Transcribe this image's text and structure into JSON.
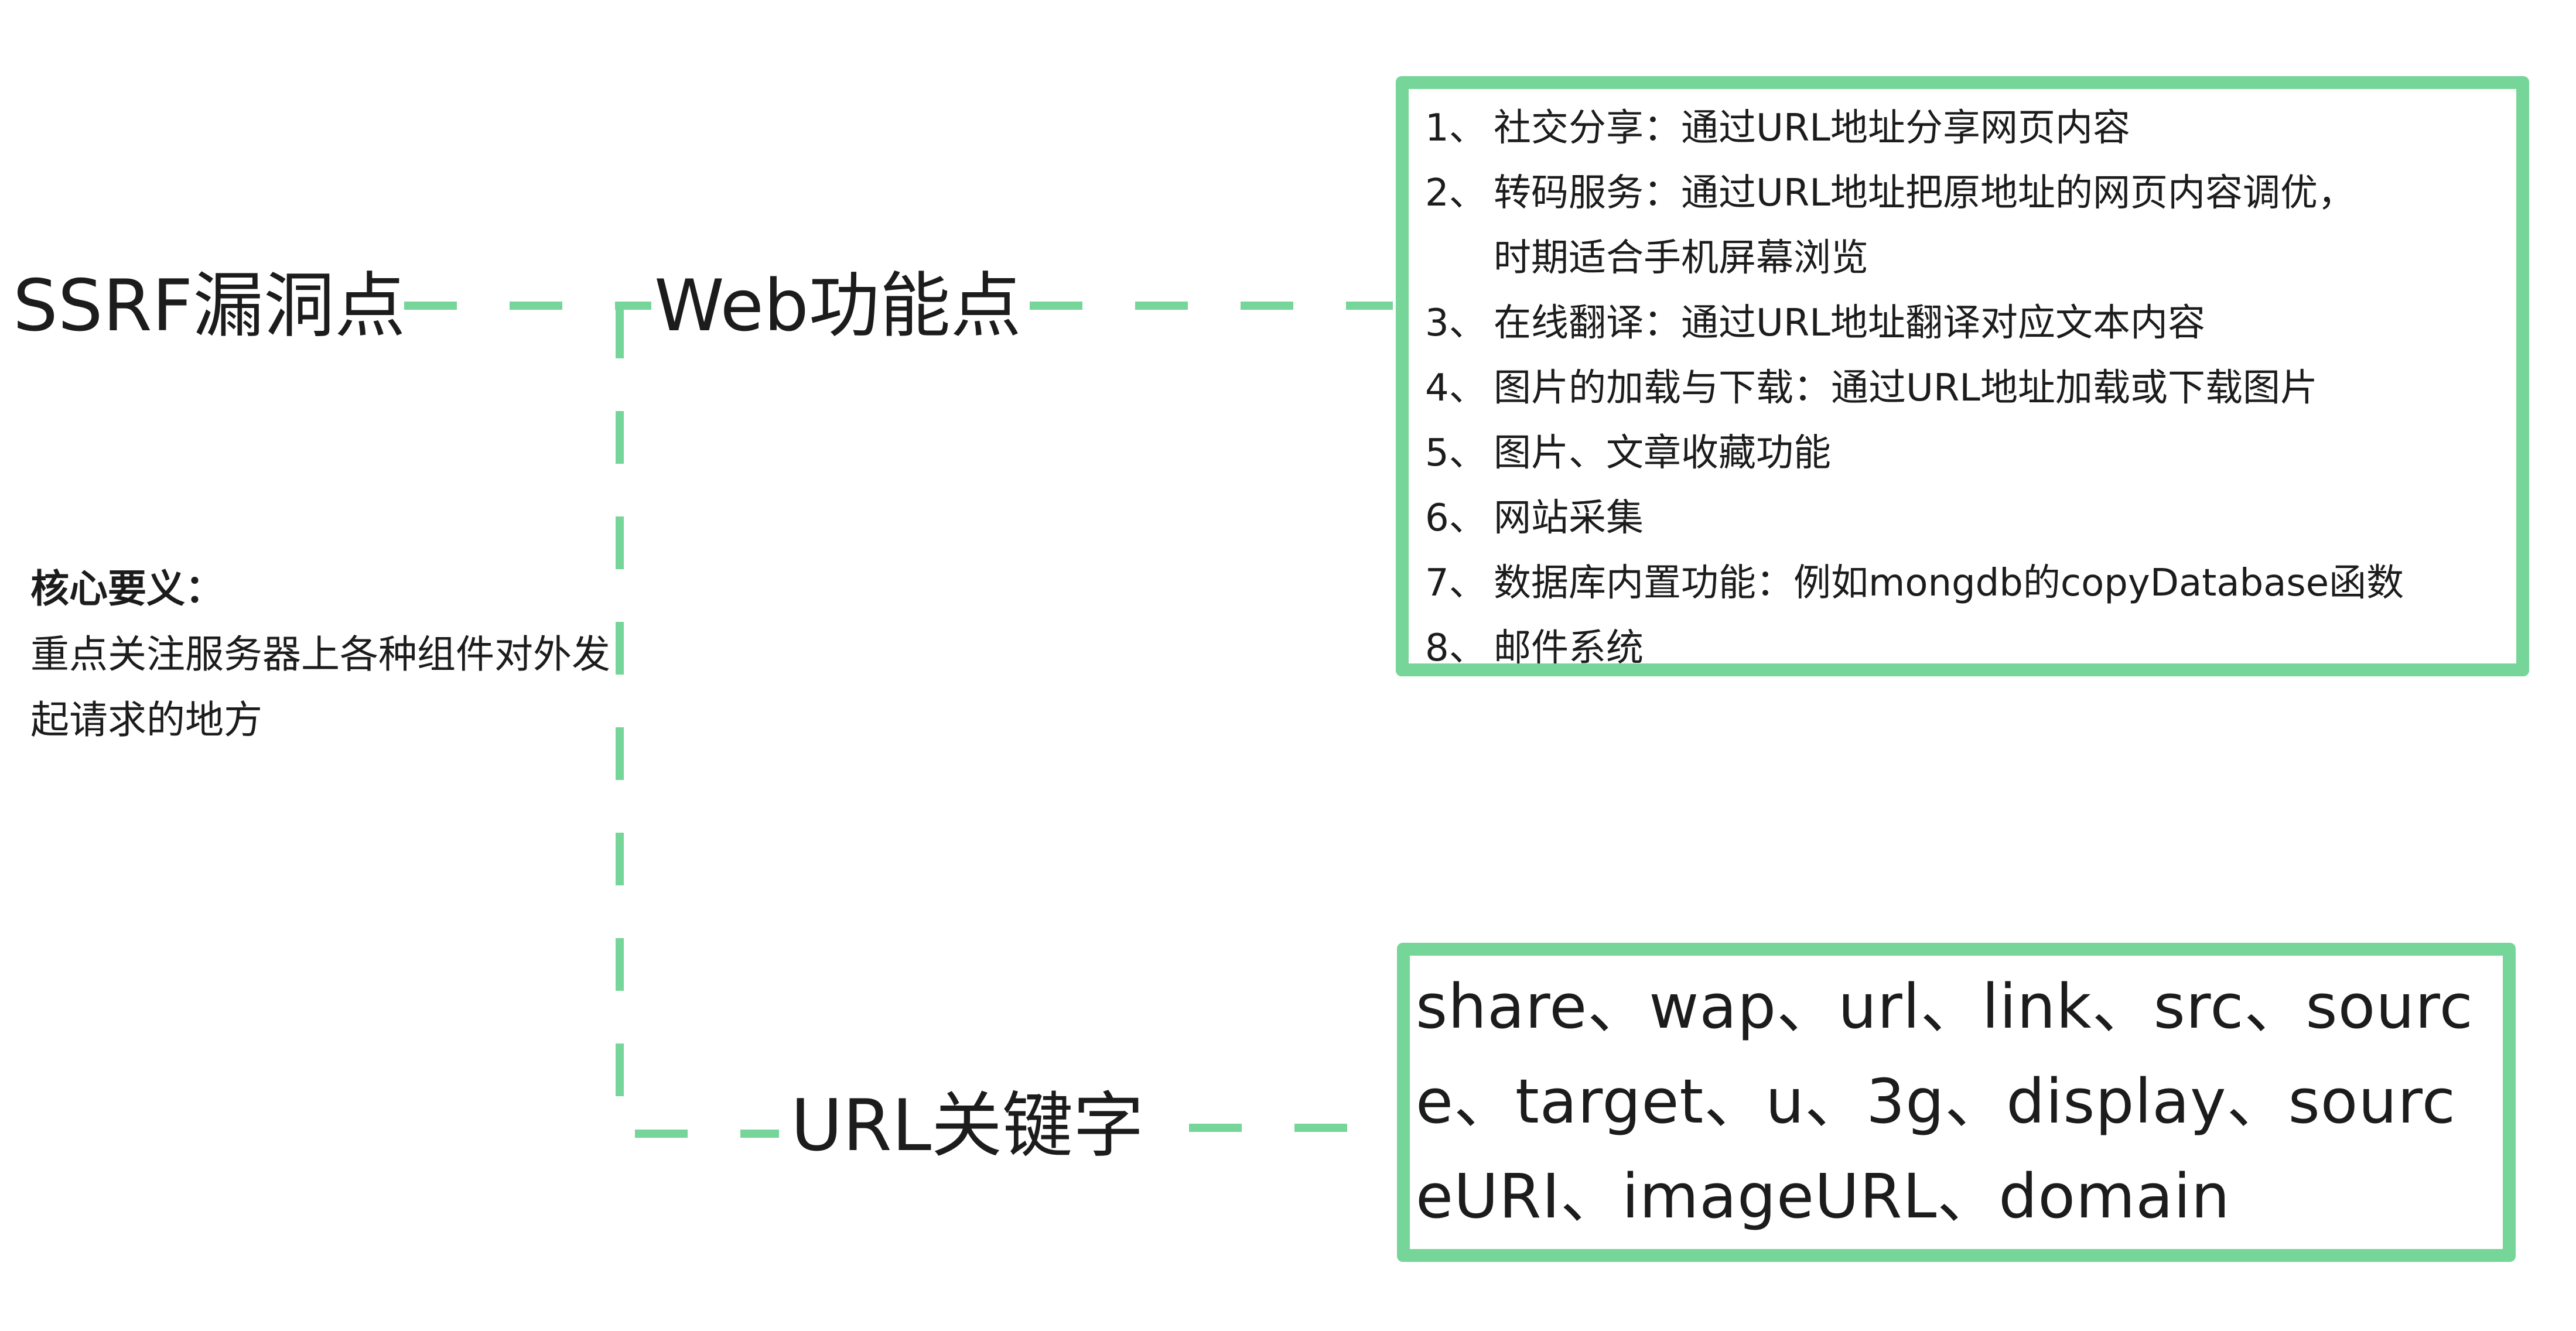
{
  "nodes": {
    "root": "SSRF漏洞点",
    "web": "Web功能点",
    "url": "URL关键字"
  },
  "core_note": {
    "heading": "核心要义：",
    "body": "重点关注服务器上各种组件对外发起请求的地方"
  },
  "features": [
    {
      "num": "1、",
      "text": "社交分享：通过URL地址分享网页内容"
    },
    {
      "num": "2、",
      "text": "转码服务：通过URL地址把原地址的网页内容调优，",
      "cont": "时期适合手机屏幕浏览"
    },
    {
      "num": "3、",
      "text": "在线翻译：通过URL地址翻译对应文本内容"
    },
    {
      "num": "4、",
      "text": "图片的加载与下载：通过URL地址加载或下载图片"
    },
    {
      "num": "5、",
      "text": "图片、文章收藏功能"
    },
    {
      "num": "6、",
      "text": "网站采集"
    },
    {
      "num": "7、",
      "text": "数据库内置功能：例如mongdb的copyDatabase函数"
    },
    {
      "num": "8、",
      "text": "邮件系统"
    }
  ],
  "keywords": "share、wap、url、link、src、source、target、u、3g、display、sourceURI、imageURL、domain",
  "colors": {
    "accent": "#76d598",
    "text": "#1c1c1c",
    "background": "#ffffff"
  }
}
